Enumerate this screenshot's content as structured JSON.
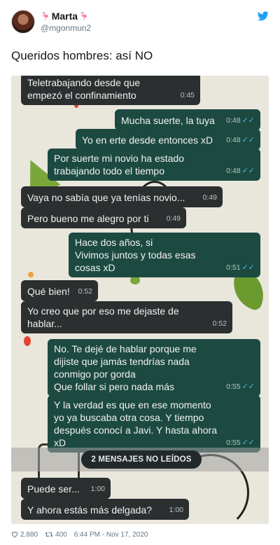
{
  "author": {
    "name": "Marta",
    "emoji_left": "🦩",
    "emoji_right": "🦩",
    "handle": "@mgonmun2"
  },
  "tweet": {
    "text": "Queridos hombres: así NO"
  },
  "chat": {
    "messages": [
      {
        "side": "in",
        "text": "Teletrabajando desde que empezó el confinamiento",
        "time": "0:45"
      },
      {
        "side": "out",
        "text": "Mucha suerte, la tuya",
        "time": "0:48",
        "ticks": "✓✓"
      },
      {
        "side": "out",
        "text": "Yo en erte desde entonces xD",
        "time": "0:48",
        "ticks": "✓✓"
      },
      {
        "side": "out",
        "text": "Por suerte mi novio ha estado trabajando todo el tiempo",
        "time": "0:48",
        "ticks": "✓✓"
      },
      {
        "side": "in",
        "text": "Vaya no sabía que ya tenías novio...",
        "time": "0:49"
      },
      {
        "side": "in",
        "text": "Pero bueno me alegro por ti",
        "time": "0:49"
      },
      {
        "side": "out",
        "text": "Hace dos años, si\nVivimos juntos y todas esas cosas xD",
        "time": "0:51",
        "ticks": "✓✓"
      },
      {
        "side": "in",
        "text": "Qué bien!",
        "time": "0:52"
      },
      {
        "side": "in",
        "text": "Yo creo que por eso me dejaste de hablar...",
        "time": "0:52"
      },
      {
        "side": "out",
        "text": "No. Te dejé de hablar porque me dijiste que jamás tendrías nada conmigo por gorda\nQue follar si pero nada más",
        "time": "0:55",
        "ticks": "✓✓"
      },
      {
        "side": "out",
        "text": "Y la verdad es que en ese momento yo ya buscaba otra cosa. Y tiempo después conocí a Javi. Y hasta ahora xD",
        "time": "0:55",
        "ticks": "✓✓"
      },
      {
        "side": "in",
        "text": "Puede ser...",
        "time": "1:00"
      },
      {
        "side": "in",
        "text": "Y ahora estás más delgada?",
        "time": "1:00"
      }
    ],
    "unread_label": "2 MENSAJES NO LEÍDOS"
  },
  "footer": {
    "likes": "2,880",
    "retweets": "400",
    "timestamp": "6:44 PM - Nov 17, 2020"
  },
  "colors": {
    "twitter_blue": "#1da1f2",
    "bubble_out": "#1c4a41",
    "bubble_in": "#2b2f30",
    "read_ticks": "#4fb3e8"
  }
}
